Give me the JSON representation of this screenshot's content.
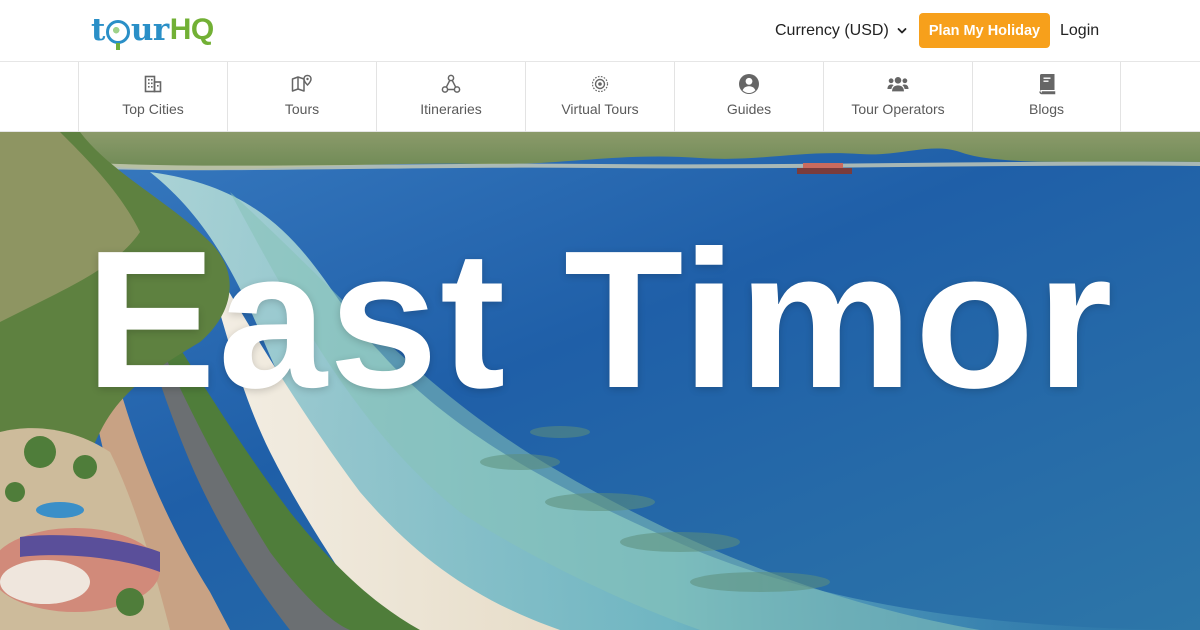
{
  "brand": {
    "logo_text_left": "tour",
    "logo_text_right": "HQ",
    "colors": {
      "blue": "#2a8fc7",
      "green": "#72b035",
      "accent": "#f7a01b"
    }
  },
  "header": {
    "currency_label": "Currency (USD)",
    "plan_button_label": "Plan My Holiday",
    "login_label": "Login"
  },
  "category_nav": {
    "items": [
      {
        "label": "Top Cities",
        "icon": "city-building-icon"
      },
      {
        "label": "Tours",
        "icon": "map-pin-icon"
      },
      {
        "label": "Itineraries",
        "icon": "route-nodes-icon"
      },
      {
        "label": "Virtual Tours",
        "icon": "target-icon"
      },
      {
        "label": "Guides",
        "icon": "user-circle-icon"
      },
      {
        "label": "Tour Operators",
        "icon": "users-group-icon"
      },
      {
        "label": "Blogs",
        "icon": "book-icon"
      }
    ]
  },
  "hero": {
    "title": "East Timor"
  }
}
